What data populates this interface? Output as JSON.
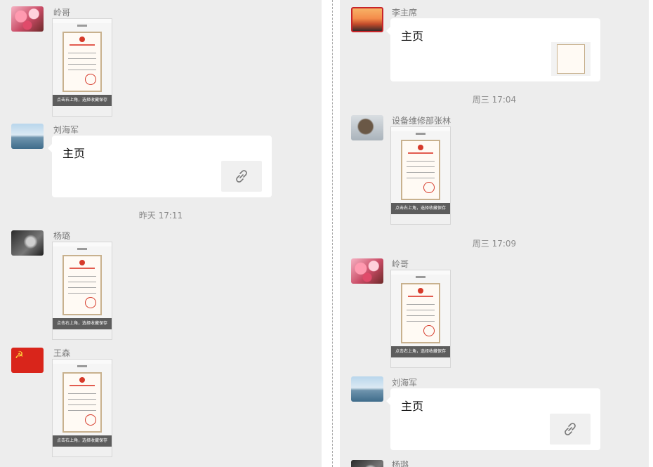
{
  "left": {
    "messages": [
      {
        "sender": "岭哥",
        "type": "image"
      },
      {
        "sender": "刘海军",
        "type": "link",
        "title": "主页"
      },
      {
        "timestamp": "昨天 17:11"
      },
      {
        "sender": "杨璐",
        "type": "image"
      },
      {
        "sender": "王森",
        "type": "image"
      }
    ]
  },
  "right": {
    "messages": [
      {
        "sender": "李主席",
        "type": "link",
        "title": "主页"
      },
      {
        "timestamp": "周三 17:04"
      },
      {
        "sender": "设备维修部张林",
        "type": "image"
      },
      {
        "timestamp": "周三 17:09"
      },
      {
        "sender": "岭哥",
        "type": "image"
      },
      {
        "sender": "刘海军",
        "type": "link",
        "title": "主页"
      },
      {
        "sender": "杨璐"
      }
    ]
  },
  "thumb": {
    "caption": "点击右上角，选择收藏保存",
    "header_label": "主页"
  },
  "icons": {
    "link": "link-icon",
    "party_emblem": "☭"
  },
  "colors": {
    "background": "#ededed",
    "bubble": "#ffffff",
    "timestamp": "#8a8a8a",
    "sender_name": "#7a7a7a"
  }
}
